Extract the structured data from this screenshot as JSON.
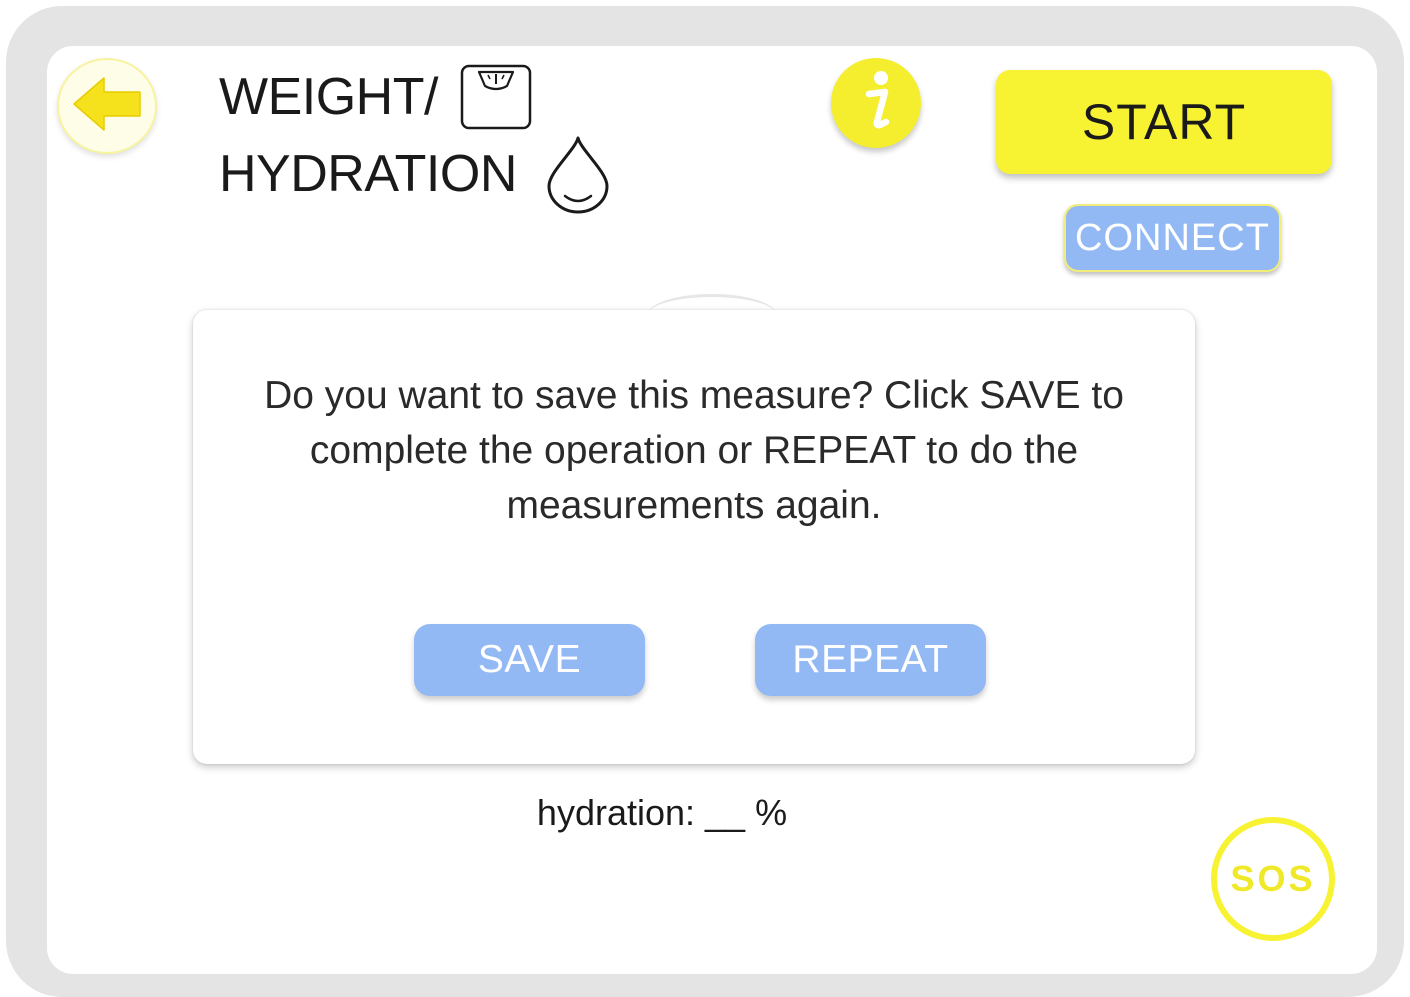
{
  "title": {
    "line1": "WEIGHT/",
    "line2": "HYDRATION",
    "scale_icon": "scale-icon",
    "drop_icon": "water-drop-icon"
  },
  "header": {
    "back_icon": "arrow-left-icon",
    "info_icon": "info-icon",
    "start_label": "START",
    "connect_label": "CONNECT"
  },
  "dialog": {
    "message": "Do you want to save this measure? Click SAVE to complete the operation or REPEAT to do the measurements again.",
    "save_label": "SAVE",
    "repeat_label": "REPEAT"
  },
  "readout": {
    "hydration": "hydration: __ %"
  },
  "sos": {
    "label": "SOS"
  },
  "colors": {
    "accent_yellow": "#f7f232",
    "button_blue": "#93b9f5",
    "device_frame": "#e4e4e4"
  }
}
